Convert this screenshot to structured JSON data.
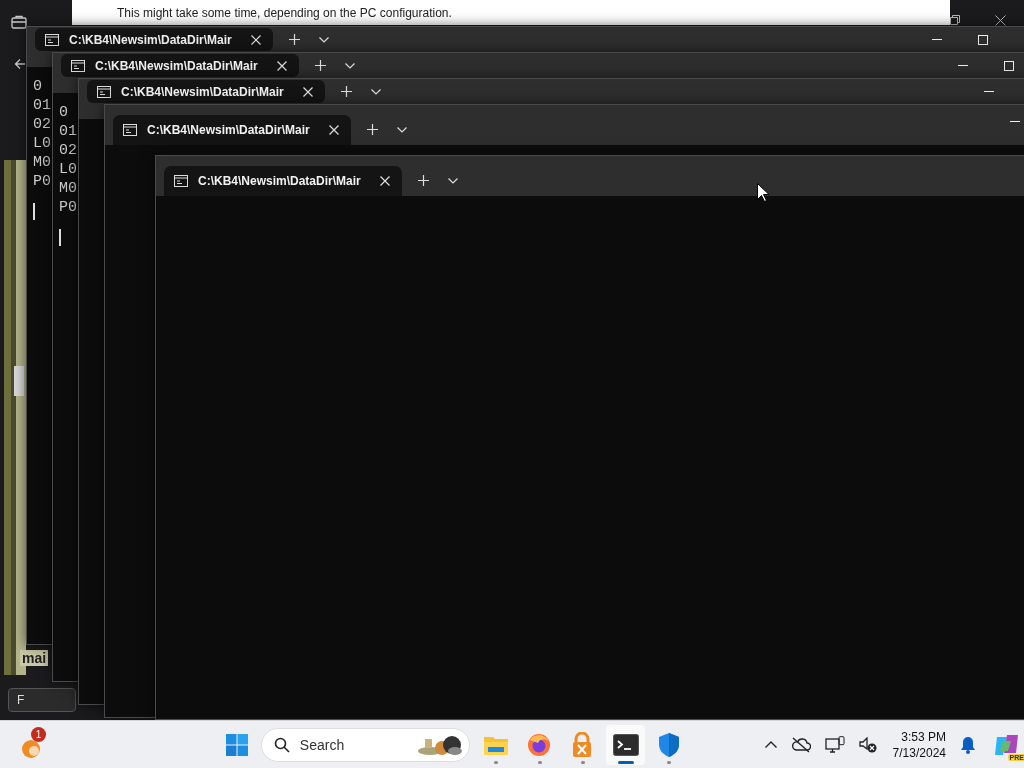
{
  "background": {
    "dialog_message": "This might take some time, depending on the PC configuration.",
    "side_app": {
      "label": "mai",
      "field_value": "F"
    }
  },
  "terminals": [
    {
      "tab_title": "C:\\KB4\\Newsim\\DataDir\\Mair",
      "lines": [
        "0",
        "01",
        "02",
        "L0",
        "M0",
        "P0"
      ],
      "cursor": true,
      "window_buttons": [
        {
          "kind": "minimize"
        },
        {
          "kind": "maximize"
        }
      ]
    },
    {
      "tab_title": "C:\\KB4\\Newsim\\DataDir\\Mair",
      "lines": [
        "0",
        "01",
        "02",
        "L0",
        "M0",
        "P0"
      ],
      "cursor": true,
      "window_buttons": [
        {
          "kind": "minimize"
        },
        {
          "kind": "maximize"
        }
      ]
    },
    {
      "tab_title": "C:\\KB4\\Newsim\\DataDir\\Mair",
      "cursor": false,
      "window_buttons": [
        {
          "kind": "minimize"
        }
      ]
    },
    {
      "tab_title": "C:\\KB4\\Newsim\\DataDir\\Mair",
      "cursor": false,
      "window_buttons": [
        {
          "kind": "minimize"
        }
      ]
    },
    {
      "tab_title": "C:\\KB4\\Newsim\\DataDir\\Mair",
      "cursor": false
    }
  ],
  "taskbar": {
    "widgets_badge": "1",
    "search": {
      "placeholder": "Search"
    },
    "apps": [
      {
        "kind": "file-explorer",
        "selected": false
      },
      {
        "kind": "browser",
        "selected": false
      },
      {
        "kind": "vpn",
        "selected": false
      },
      {
        "kind": "terminal",
        "selected": true
      },
      {
        "kind": "security",
        "selected": false
      }
    ],
    "time": "3:53 PM",
    "date": "7/13/2024",
    "copilot_badge": "PRE"
  }
}
